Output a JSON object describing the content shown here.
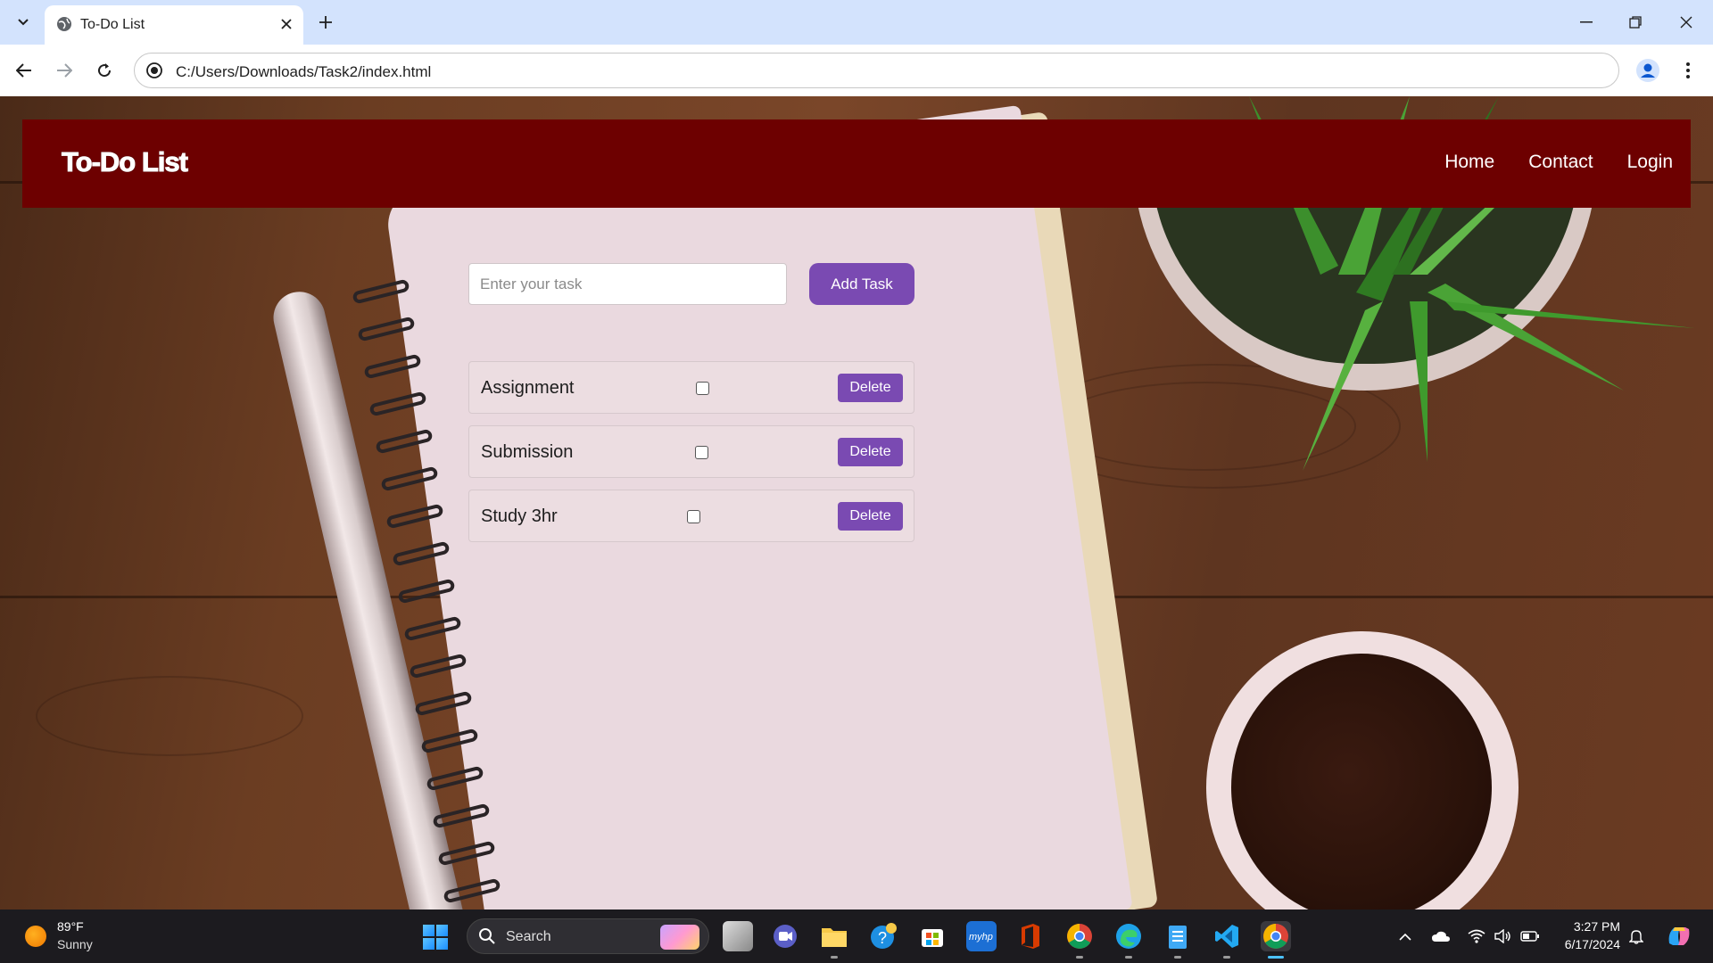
{
  "browser": {
    "tab_title": "To-Do List",
    "url": "C:/Users/Downloads/Task2/index.html",
    "icons": [
      "tab-search-icon",
      "globe-icon",
      "close-icon",
      "plus-icon",
      "minimize-icon",
      "restore-icon",
      "window-close-icon",
      "back-arrow-icon",
      "forward-arrow-icon",
      "reload-icon",
      "site-info-icon",
      "profile-icon",
      "kebab-menu-icon"
    ]
  },
  "navbar": {
    "brand": "To-Do List",
    "links": [
      "Home",
      "Contact",
      "Login"
    ],
    "background": "#6d0000"
  },
  "todo": {
    "input_placeholder": "Enter your task",
    "add_button": "Add Task",
    "accent": "#7a4ab2",
    "tasks": [
      {
        "text": "Assignment",
        "checked": false,
        "delete_label": "Delete"
      },
      {
        "text": "Submission",
        "checked": false,
        "delete_label": "Delete"
      },
      {
        "text": "Study 3hr",
        "checked": false,
        "delete_label": "Delete"
      }
    ]
  },
  "taskbar": {
    "weather_temp": "89°F",
    "weather_desc": "Sunny",
    "search_label": "Search",
    "time": "3:27 PM",
    "date": "6/17/2024",
    "apps": [
      "start-icon",
      "task-view-icon",
      "teams-icon",
      "file-explorer-icon",
      "help-icon",
      "store-icon",
      "myhp-icon",
      "office-icon",
      "chrome-icon",
      "edge-icon",
      "notepad-icon",
      "vscode-icon",
      "chrome-active-icon"
    ],
    "tray": [
      "chevron-up-icon",
      "onedrive-icon",
      "wifi-icon",
      "volume-icon",
      "battery-icon",
      "bell-icon",
      "copilot-icon"
    ]
  }
}
